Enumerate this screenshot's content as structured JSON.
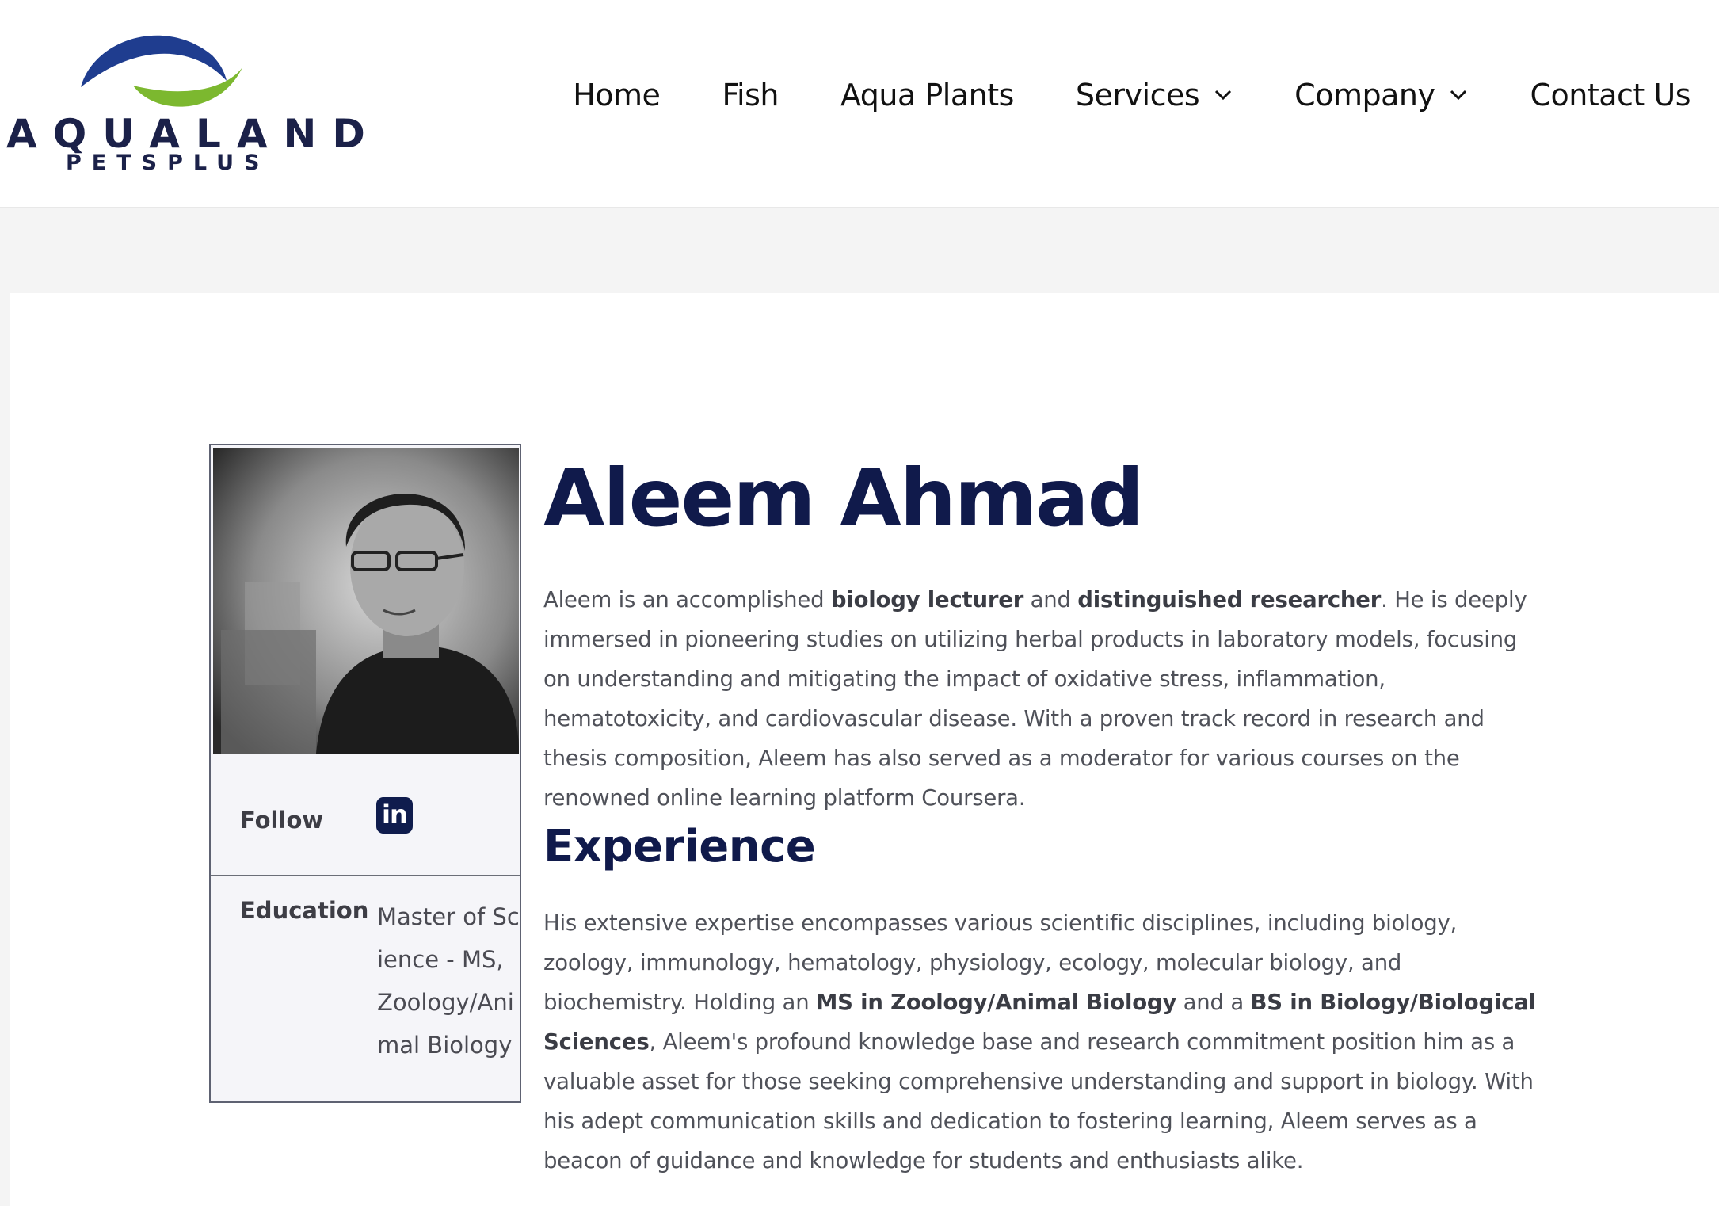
{
  "brand": {
    "name": "AQUALAND",
    "tagline": "PETSPLUS",
    "colors": {
      "navy": "#1b2149",
      "blue": "#1f3d8f",
      "green": "#7cb82f"
    }
  },
  "nav": {
    "items": [
      {
        "label": "Home",
        "has_dropdown": false
      },
      {
        "label": "Fish",
        "has_dropdown": false
      },
      {
        "label": "Aqua Plants",
        "has_dropdown": false
      },
      {
        "label": "Services",
        "has_dropdown": true
      },
      {
        "label": "Company",
        "has_dropdown": true
      },
      {
        "label": "Contact Us",
        "has_dropdown": false
      }
    ]
  },
  "profile": {
    "name": "Aleem Ahmad",
    "follow_label": "Follow",
    "social_icon": "linkedin-icon",
    "education_label": "Education",
    "education_value": "Master of Science - MS, Zoology/Animal Biology"
  },
  "bio": {
    "p1_a": "Aleem is an accomplished ",
    "p1_b": "biology lecturer",
    "p1_c": " and ",
    "p1_d": "distinguished researcher",
    "p1_e": ". He is deeply immersed in pioneering studies on utilizing herbal products in laboratory models, focusing on understanding and mitigating the impact of oxidative stress, inflammation, hematotoxicity, and cardiovascular disease. With a proven track record in research and thesis composition, Aleem has also served as a moderator for various courses on the renowned online learning platform Coursera."
  },
  "experience": {
    "heading": "Experience",
    "p_a": "His extensive expertise encompasses various scientific disciplines, including biology, zoology, immunology, hematology, physiology, ecology, molecular biology, and biochemistry. Holding an ",
    "p_b": "MS in Zoology/Animal Biology",
    "p_c": " and a ",
    "p_d": "BS in Biology/Biological Sciences",
    "p_e": ", Aleem's profound knowledge base and research commitment position him as a valuable asset for those seeking comprehensive understanding and support in biology. With his adept communication skills and dedication to fostering learning, Aleem serves as a beacon of guidance and knowledge for students and enthusiasts alike."
  }
}
